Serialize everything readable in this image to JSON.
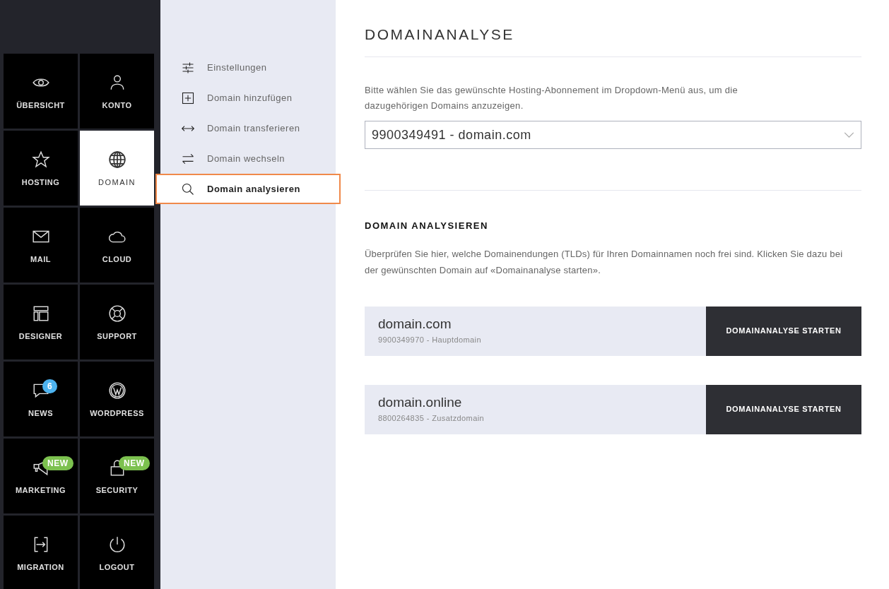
{
  "tiles": [
    {
      "label": "ÜBERSICHT",
      "selected": false
    },
    {
      "label": "KONTO",
      "selected": false
    },
    {
      "label": "HOSTING",
      "selected": false
    },
    {
      "label": "DOMAIN",
      "selected": true
    },
    {
      "label": "MAIL",
      "selected": false
    },
    {
      "label": "CLOUD",
      "selected": false
    },
    {
      "label": "DESIGNER",
      "selected": false
    },
    {
      "label": "SUPPORT",
      "selected": false
    },
    {
      "label": "NEWS",
      "selected": false,
      "badge": {
        "text": "6",
        "color": "#4db3f0"
      }
    },
    {
      "label": "WORDPRESS",
      "selected": false
    },
    {
      "label": "MARKETING",
      "selected": false,
      "badge": {
        "text": "NEW",
        "color": "#7cc14f"
      }
    },
    {
      "label": "SECURITY",
      "selected": false,
      "badge": {
        "text": "NEW",
        "color": "#7cc14f"
      }
    },
    {
      "label": "MIGRATION",
      "selected": false
    },
    {
      "label": "LOGOUT",
      "selected": false
    }
  ],
  "submenu": [
    {
      "label": "Einstellungen",
      "selected": false
    },
    {
      "label": "Domain hinzufügen",
      "selected": false
    },
    {
      "label": "Domain transferieren",
      "selected": false
    },
    {
      "label": "Domain wechseln",
      "selected": false
    },
    {
      "label": "Domain analysieren",
      "selected": true
    }
  ],
  "title": "DOMAINANALYSE",
  "intro": "Bitte wählen Sie das gewünschte Hosting-Abonnement im Dropdown-Menü aus, um die dazugehörigen Domains anzuzeigen.",
  "subscription_select": {
    "value": "9900349491 - domain.com"
  },
  "section": {
    "heading": "DOMAIN ANALYSIEREN",
    "text": "Überprüfen Sie hier, welche Domainendungen (TLDs) für Ihren Domainnamen noch frei sind. Klicken Sie dazu bei der gewünschten Domain auf «Domainanalyse starten»."
  },
  "domains": [
    {
      "name": "domain.com",
      "detail": "9900349970 - Hauptdomain",
      "button": "DOMAINANALYSE STARTEN"
    },
    {
      "name": "domain.online",
      "detail": "8800264835 - Zusatzdomain",
      "button": "DOMAINANALYSE STARTEN"
    }
  ]
}
